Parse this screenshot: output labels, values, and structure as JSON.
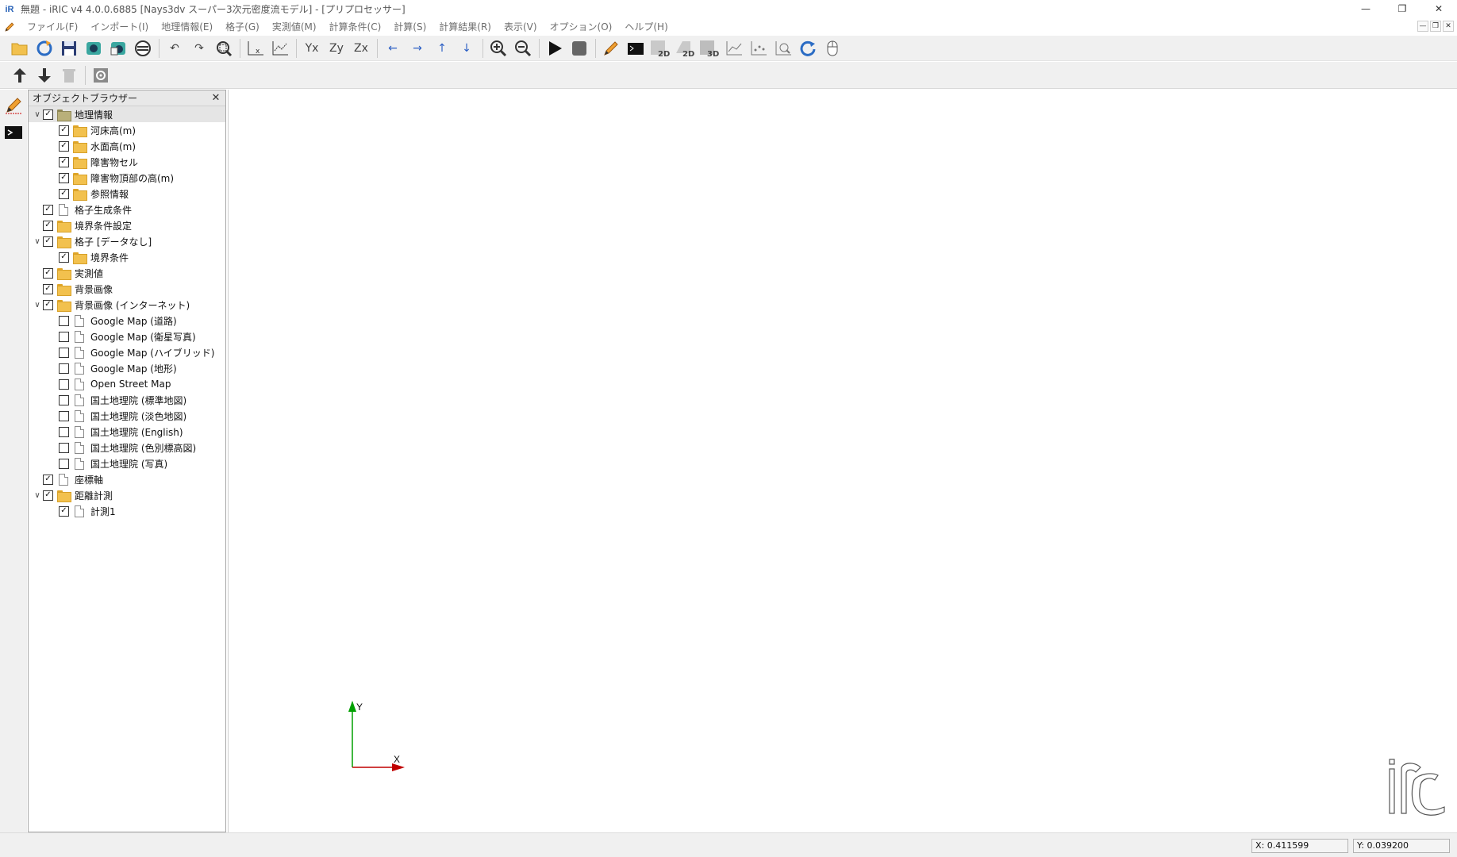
{
  "window": {
    "title": "無題 - iRIC v4 4.0.0.6885 [Nays3dv スーパー3次元密度流モデル] - [プリプロセッサー]",
    "app_icon": "iric-logo-icon"
  },
  "menubar": {
    "items": [
      "ファイル(F)",
      "インポート(I)",
      "地理情報(E)",
      "格子(G)",
      "実測値(M)",
      "計算条件(C)",
      "計算(S)",
      "計算結果(R)",
      "表示(V)",
      "オプション(O)",
      "ヘルプ(H)"
    ]
  },
  "toolbar": {
    "axis_labels": {
      "yx": "Yx",
      "zy": "Zy",
      "zx": "Zx",
      "two_d": "2D",
      "two_d_b": "2D",
      "three_d": "3D"
    }
  },
  "object_browser": {
    "title": "オブジェクトブラウザー",
    "close": "✕",
    "items": [
      {
        "label": "地理情報",
        "level": 0,
        "expanded": true,
        "checked": true,
        "icon": "folder-icon",
        "selected": true
      },
      {
        "label": "河床高(m)",
        "level": 1,
        "checked": true,
        "icon": "folder-icon"
      },
      {
        "label": "水面高(m)",
        "level": 1,
        "checked": true,
        "icon": "folder-icon"
      },
      {
        "label": "障害物セル",
        "level": 1,
        "checked": true,
        "icon": "folder-icon"
      },
      {
        "label": "障害物頂部の高(m)",
        "level": 1,
        "checked": true,
        "icon": "folder-icon"
      },
      {
        "label": "参照情報",
        "level": 1,
        "checked": true,
        "icon": "folder-icon"
      },
      {
        "label": "格子生成条件",
        "level": 0,
        "checked": true,
        "icon": "document-icon"
      },
      {
        "label": "境界条件設定",
        "level": 0,
        "checked": true,
        "icon": "folder-icon"
      },
      {
        "label": "格子 [データなし]",
        "level": 0,
        "expanded": true,
        "checked": true,
        "icon": "folder-icon"
      },
      {
        "label": "境界条件",
        "level": 1,
        "checked": true,
        "icon": "folder-icon"
      },
      {
        "label": "実測値",
        "level": 0,
        "checked": true,
        "icon": "folder-icon"
      },
      {
        "label": "背景画像",
        "level": 0,
        "checked": true,
        "icon": "folder-icon"
      },
      {
        "label": "背景画像 (インターネット)",
        "level": 0,
        "expanded": true,
        "checked": true,
        "icon": "folder-icon"
      },
      {
        "label": "Google Map (道路)",
        "level": 1,
        "checked": false,
        "icon": "document-icon"
      },
      {
        "label": "Google Map (衛星写真)",
        "level": 1,
        "checked": false,
        "icon": "document-icon"
      },
      {
        "label": "Google Map (ハイブリッド)",
        "level": 1,
        "checked": false,
        "icon": "document-icon"
      },
      {
        "label": "Google Map (地形)",
        "level": 1,
        "checked": false,
        "icon": "document-icon"
      },
      {
        "label": "Open Street Map",
        "level": 1,
        "checked": false,
        "icon": "document-icon"
      },
      {
        "label": "国土地理院 (標準地図)",
        "level": 1,
        "checked": false,
        "icon": "document-icon"
      },
      {
        "label": "国土地理院 (淡色地図)",
        "level": 1,
        "checked": false,
        "icon": "document-icon"
      },
      {
        "label": "国土地理院 (English)",
        "level": 1,
        "checked": false,
        "icon": "document-icon"
      },
      {
        "label": "国土地理院 (色別標高図)",
        "level": 1,
        "checked": false,
        "icon": "document-icon"
      },
      {
        "label": "国土地理院 (写真)",
        "level": 1,
        "checked": false,
        "icon": "document-icon"
      },
      {
        "label": "座標軸",
        "level": 0,
        "checked": true,
        "icon": "document-icon"
      },
      {
        "label": "距離計測",
        "level": 0,
        "expanded": true,
        "checked": true,
        "icon": "folder-icon"
      },
      {
        "label": "計測1",
        "level": 1,
        "checked": true,
        "icon": "document-icon"
      }
    ]
  },
  "viewport": {
    "axis_x_label": "X",
    "axis_y_label": "Y",
    "x_axis_color": "#c00000",
    "y_axis_color": "#00a000"
  },
  "statusbar": {
    "x_coord": "X: 0.411599",
    "y_coord": "Y: 0.039200"
  }
}
